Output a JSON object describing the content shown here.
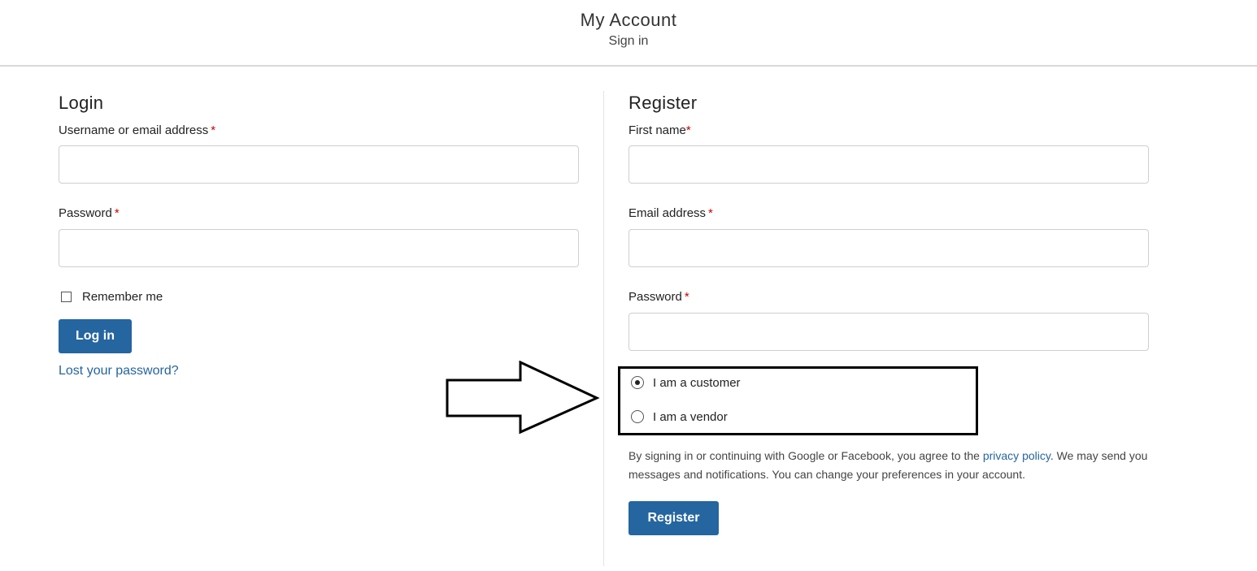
{
  "header": {
    "title": "My Account",
    "subtitle": "Sign in"
  },
  "login": {
    "title": "Login",
    "username_label": "Username or email address",
    "password_label": "Password",
    "required_mark": "*",
    "remember_label": "Remember me",
    "login_button": "Log in",
    "lost_password_link": "Lost your password?"
  },
  "register": {
    "title": "Register",
    "first_name_label": "First name",
    "email_label": "Email address",
    "password_label": "Password",
    "required_mark": "*",
    "role_options": [
      {
        "label": "I am a customer",
        "checked": true
      },
      {
        "label": "I am a vendor",
        "checked": false
      }
    ],
    "policy_before": "By signing in or continuing with Google or Facebook, you agree to the ",
    "policy_link": "privacy policy",
    "policy_after": ". We may send you messages and notifications. You can change your preferences in your account.",
    "register_button": "Register"
  },
  "colors": {
    "accent": "#2565a0",
    "required": "#cc0000",
    "annotation": "#000000"
  },
  "icons": {
    "annotation": "arrow-right-icon"
  }
}
